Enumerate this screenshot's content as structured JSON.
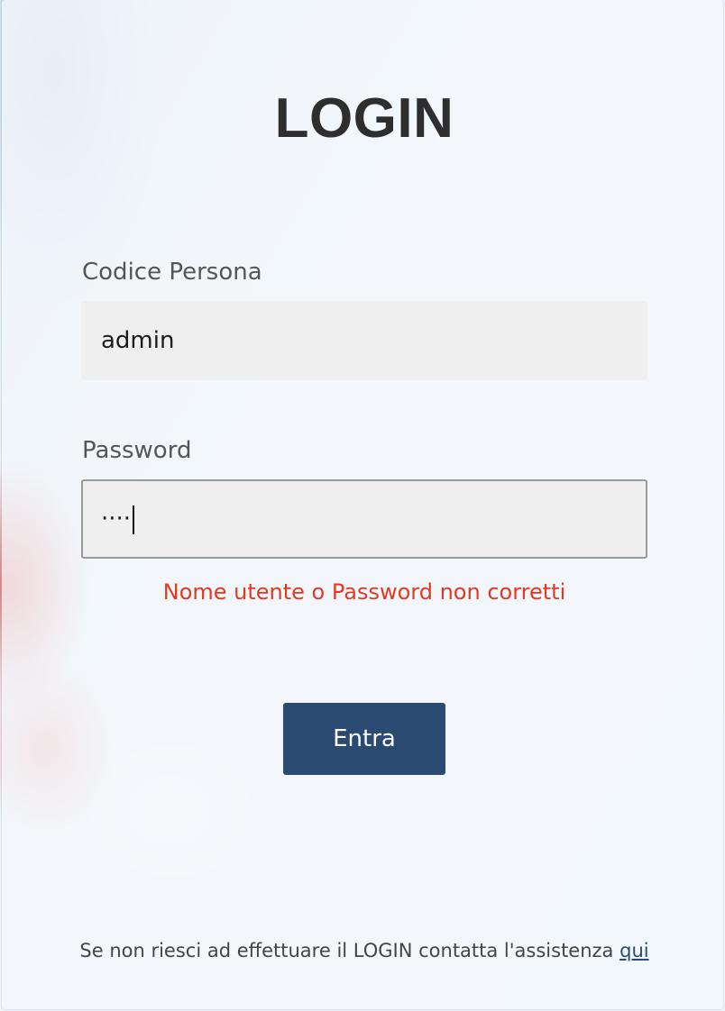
{
  "login": {
    "title": "LOGIN",
    "username": {
      "label": "Codice Persona",
      "value": "admin"
    },
    "password": {
      "label": "Password",
      "masked_value": "····"
    },
    "error_message": "Nome utente o Password non corretti",
    "submit_label": "Entra",
    "help_text": "Se non riesci ad effettuare il LOGIN contatta l'assistenza ",
    "help_link_label": "qui"
  },
  "colors": {
    "primary_button": "#2b4a72",
    "error": "#e03a22",
    "title": "#2e2e2e",
    "field_background": "#efefef"
  }
}
